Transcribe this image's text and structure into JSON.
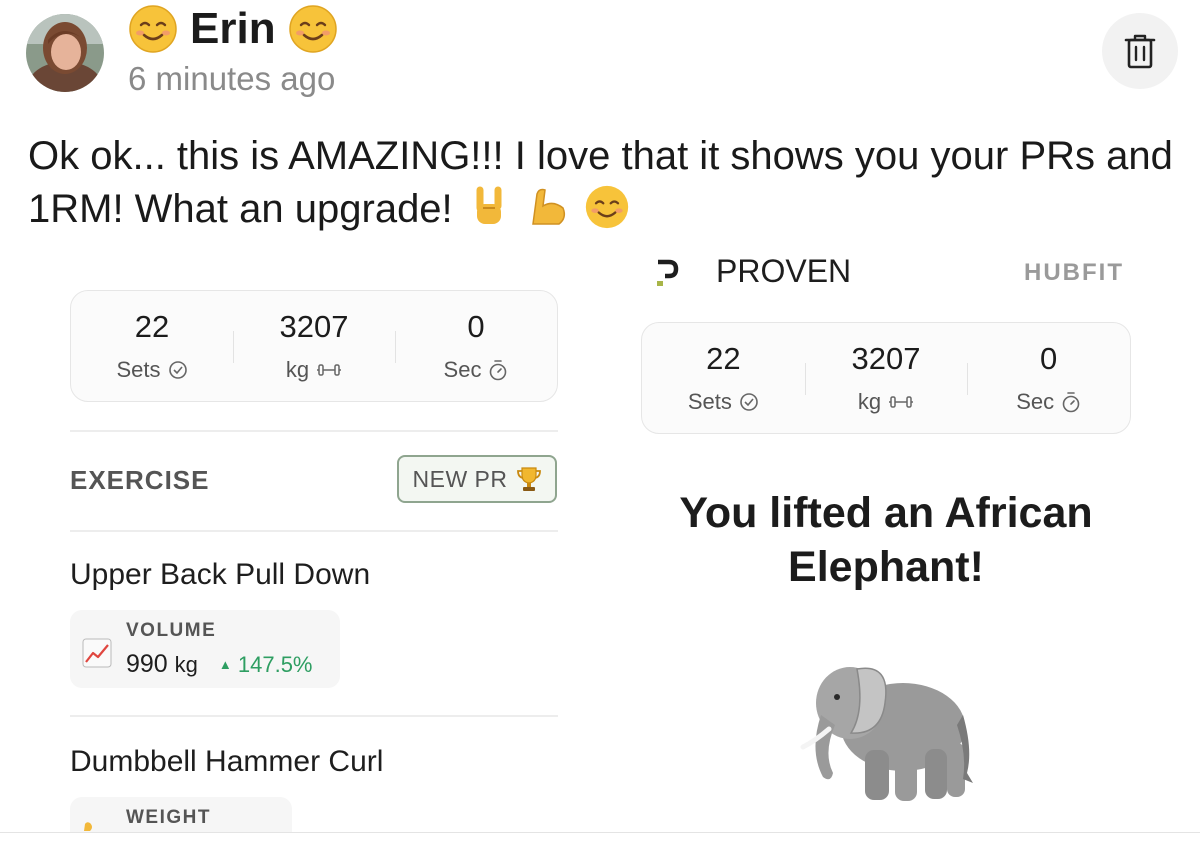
{
  "post": {
    "author": "Erin",
    "timestamp": "6 minutes ago",
    "text": "Ok ok... this is AMAZING!!! I love that it shows you your PRs and 1RM! What an upgrade!"
  },
  "left_card": {
    "stats": [
      {
        "value": "22",
        "label": "Sets",
        "icon": "check-circle-icon"
      },
      {
        "value": "3207",
        "label": "kg",
        "icon": "dumbbell-icon"
      },
      {
        "value": "0",
        "label": "Sec",
        "icon": "stopwatch-icon"
      }
    ],
    "exercise_header": "EXERCISE",
    "new_pr_label": "NEW PR",
    "exercises": [
      {
        "name": "Upper Back Pull Down",
        "metric_label": "VOLUME",
        "metric_value": "990",
        "metric_unit": "kg",
        "metric_delta": "147.5%"
      },
      {
        "name": "Dumbbell Hammer Curl",
        "metric_label": "WEIGHT"
      }
    ]
  },
  "right_card": {
    "brand_left": "PROVEN",
    "brand_right": "HUBFIT",
    "stats": [
      {
        "value": "22",
        "label": "Sets",
        "icon": "check-circle-icon"
      },
      {
        "value": "3207",
        "label": "kg",
        "icon": "dumbbell-icon"
      },
      {
        "value": "0",
        "label": "Sec",
        "icon": "stopwatch-icon"
      }
    ],
    "headline": "You lifted an African Elephant!"
  },
  "colors": {
    "accent_green": "#2e9e62",
    "pr_border": "#8fa58f",
    "muted": "#8a8a8a"
  }
}
